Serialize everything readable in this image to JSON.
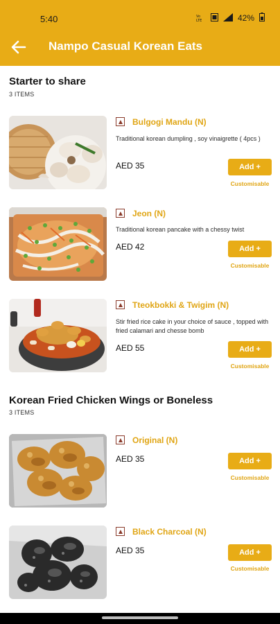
{
  "status": {
    "time": "5:40",
    "net": "Vo LTE",
    "battery": "42%"
  },
  "header": {
    "title": "Nampo Casual Korean Eats"
  },
  "sections": [
    {
      "title": "Starter to share",
      "count": "3 ITEMS",
      "items": [
        {
          "name": "Bulgogi Mandu (N)",
          "desc": "Traditional korean dumpling , soy vinaigrette ( 4pcs )",
          "price": "AED 35",
          "add": "Add +",
          "custom": "Customisable"
        },
        {
          "name": "Jeon (N)",
          "desc": "Traditional korean pancake with a chessy twist",
          "price": "AED 42",
          "add": "Add +",
          "custom": "Customisable"
        },
        {
          "name": "Tteokbokki & Twigim (N)",
          "desc": "Stir fried rice cake in your choice of sauce , topped with fried calamari and chesse bomb",
          "price": "AED 55",
          "add": "Add +",
          "custom": "Customisable"
        }
      ]
    },
    {
      "title": "Korean Fried Chicken Wings or Boneless",
      "count": "3 ITEMS",
      "items": [
        {
          "name": "Original (N)",
          "desc": "",
          "price": "AED 35",
          "add": "Add +",
          "custom": "Customisable"
        },
        {
          "name": "Black Charcoal (N)",
          "desc": "",
          "price": "AED 35",
          "add": "Add +",
          "custom": "Customisable"
        }
      ]
    }
  ],
  "colors": {
    "accent": "#e8ac16",
    "nonveg": "#8a3a2a"
  },
  "icons": {
    "back": "arrow-left-icon",
    "nonveg": "non-veg-icon"
  }
}
